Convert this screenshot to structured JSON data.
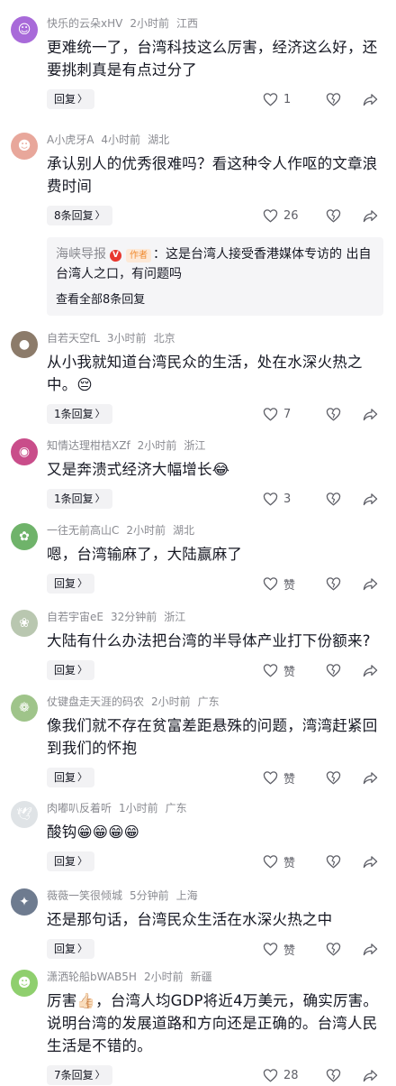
{
  "comments": [
    {
      "user": "快乐的云朵xHV",
      "time": "2小时前",
      "location": "江西",
      "text": "更难统一了，台湾科技这么厉害，经济这么好，还要挑刺真是有点过分了",
      "reply_label": "回复",
      "likes": "1",
      "avatar_color": "#a86ad9",
      "avatar_glyph": "☺"
    },
    {
      "user": "A小虎牙A",
      "time": "4小时前",
      "location": "湖北",
      "text": "承认别人的优秀很难吗？看这种令人作呕的文章浪费时间",
      "reply_label": "8条回复",
      "likes": "26",
      "avatar_color": "#e8a79b",
      "avatar_glyph": "☻",
      "sub": {
        "name": "海峡导报",
        "badge": "V",
        "tag": "作者",
        "text": "：这是台湾人接受香港媒体专访的 出自台湾人之口，有问题吗",
        "view_all": "查看全部8条回复"
      }
    },
    {
      "user": "自若天空fL",
      "time": "3小时前",
      "location": "北京",
      "text": "从小我就知道台湾民众的生活，处在水深火热之中。😔",
      "reply_label": "1条回复",
      "likes": "7",
      "avatar_color": "#8c7b6a",
      "avatar_glyph": "●"
    },
    {
      "user": "知情达理柑桔XZf",
      "time": "2小时前",
      "location": "浙江",
      "text": "又是奔溃式经济大幅增长😂",
      "reply_label": "1条回复",
      "likes": "3",
      "avatar_color": "#c94d8a",
      "avatar_glyph": "◉"
    },
    {
      "user": "一往无前高山C",
      "time": "2小时前",
      "location": "湖北",
      "text": "嗯，台湾输麻了，大陆赢麻了",
      "reply_label": "回复",
      "likes": "赞",
      "avatar_color": "#6fb36a",
      "avatar_glyph": "✿"
    },
    {
      "user": "自若宇宙eE",
      "time": "32分钟前",
      "location": "浙江",
      "text": "大陆有什么办法把台湾的半导体产业打下份额来?",
      "reply_label": "回复",
      "likes": "赞",
      "avatar_color": "#b9c7b0",
      "avatar_glyph": "❀"
    },
    {
      "user": "仗键盘走天涯的码农",
      "time": "2小时前",
      "location": "广东",
      "text": "像我们就不存在贫富差距悬殊的问题，湾湾赶紧回到我们的怀抱",
      "reply_label": "回复",
      "likes": "赞",
      "avatar_color": "#9fc48a",
      "avatar_glyph": "❁"
    },
    {
      "user": "肉嘟叭反着听",
      "time": "1小时前",
      "location": "广东",
      "text": "酸钩😁😁😁😁",
      "reply_label": "回复",
      "likes": "赞",
      "avatar_color": "#dfe3e6",
      "avatar_glyph": "🕊"
    },
    {
      "user": "薇薇一笑很倾城",
      "time": "5分钟前",
      "location": "上海",
      "text": "还是那句话，台湾民众生活在水深火热之中",
      "reply_label": "回复",
      "likes": "赞",
      "avatar_color": "#6e7b8f",
      "avatar_glyph": "✦"
    },
    {
      "user": "潇洒轮船bWAB5H",
      "time": "2小时前",
      "location": "新疆",
      "text": "厉害👍🏻，台湾人均GDP将近4万美元，确实厉害。说明台湾的发展道路和方向还是正确的。台湾人民生活是不错的。",
      "reply_label": "7条回复",
      "likes": "28",
      "avatar_color": "#8fcf6e",
      "avatar_glyph": "☻"
    }
  ]
}
